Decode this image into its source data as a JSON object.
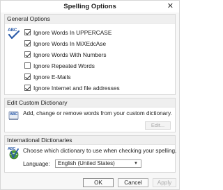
{
  "dialog": {
    "title": "Spelling Options"
  },
  "general": {
    "header": "General Options",
    "icon_label": "ABC",
    "options": [
      {
        "label": "Ignore Words In UPPERCASE",
        "checked": true
      },
      {
        "label": "Ignore Words In MiXEdcAse",
        "checked": true
      },
      {
        "label": "Ignore Words With Numbers",
        "checked": true
      },
      {
        "label": "Ignore Repeated Words",
        "checked": false
      },
      {
        "label": "Ignore E-Mails",
        "checked": true
      },
      {
        "label": "Ignore Internet and file addresses",
        "checked": true
      }
    ]
  },
  "custom": {
    "header": "Edit Custom Dictionary",
    "icon_label": "ABC",
    "description": "Add, change or remove words from your custom dictionary.",
    "edit_label": "Edit..."
  },
  "international": {
    "header": "International Dictionaries",
    "icon_label": "ABC",
    "description": "Choose which dictionary to use when checking your spelling.",
    "language_label": "Language:",
    "language_value": "English (United States)"
  },
  "buttons": {
    "ok": "OK",
    "cancel": "Cancel",
    "apply": "Apply"
  },
  "colors": {
    "check_accent": "#2a5aa8",
    "book_green": "#3f8f2f"
  }
}
